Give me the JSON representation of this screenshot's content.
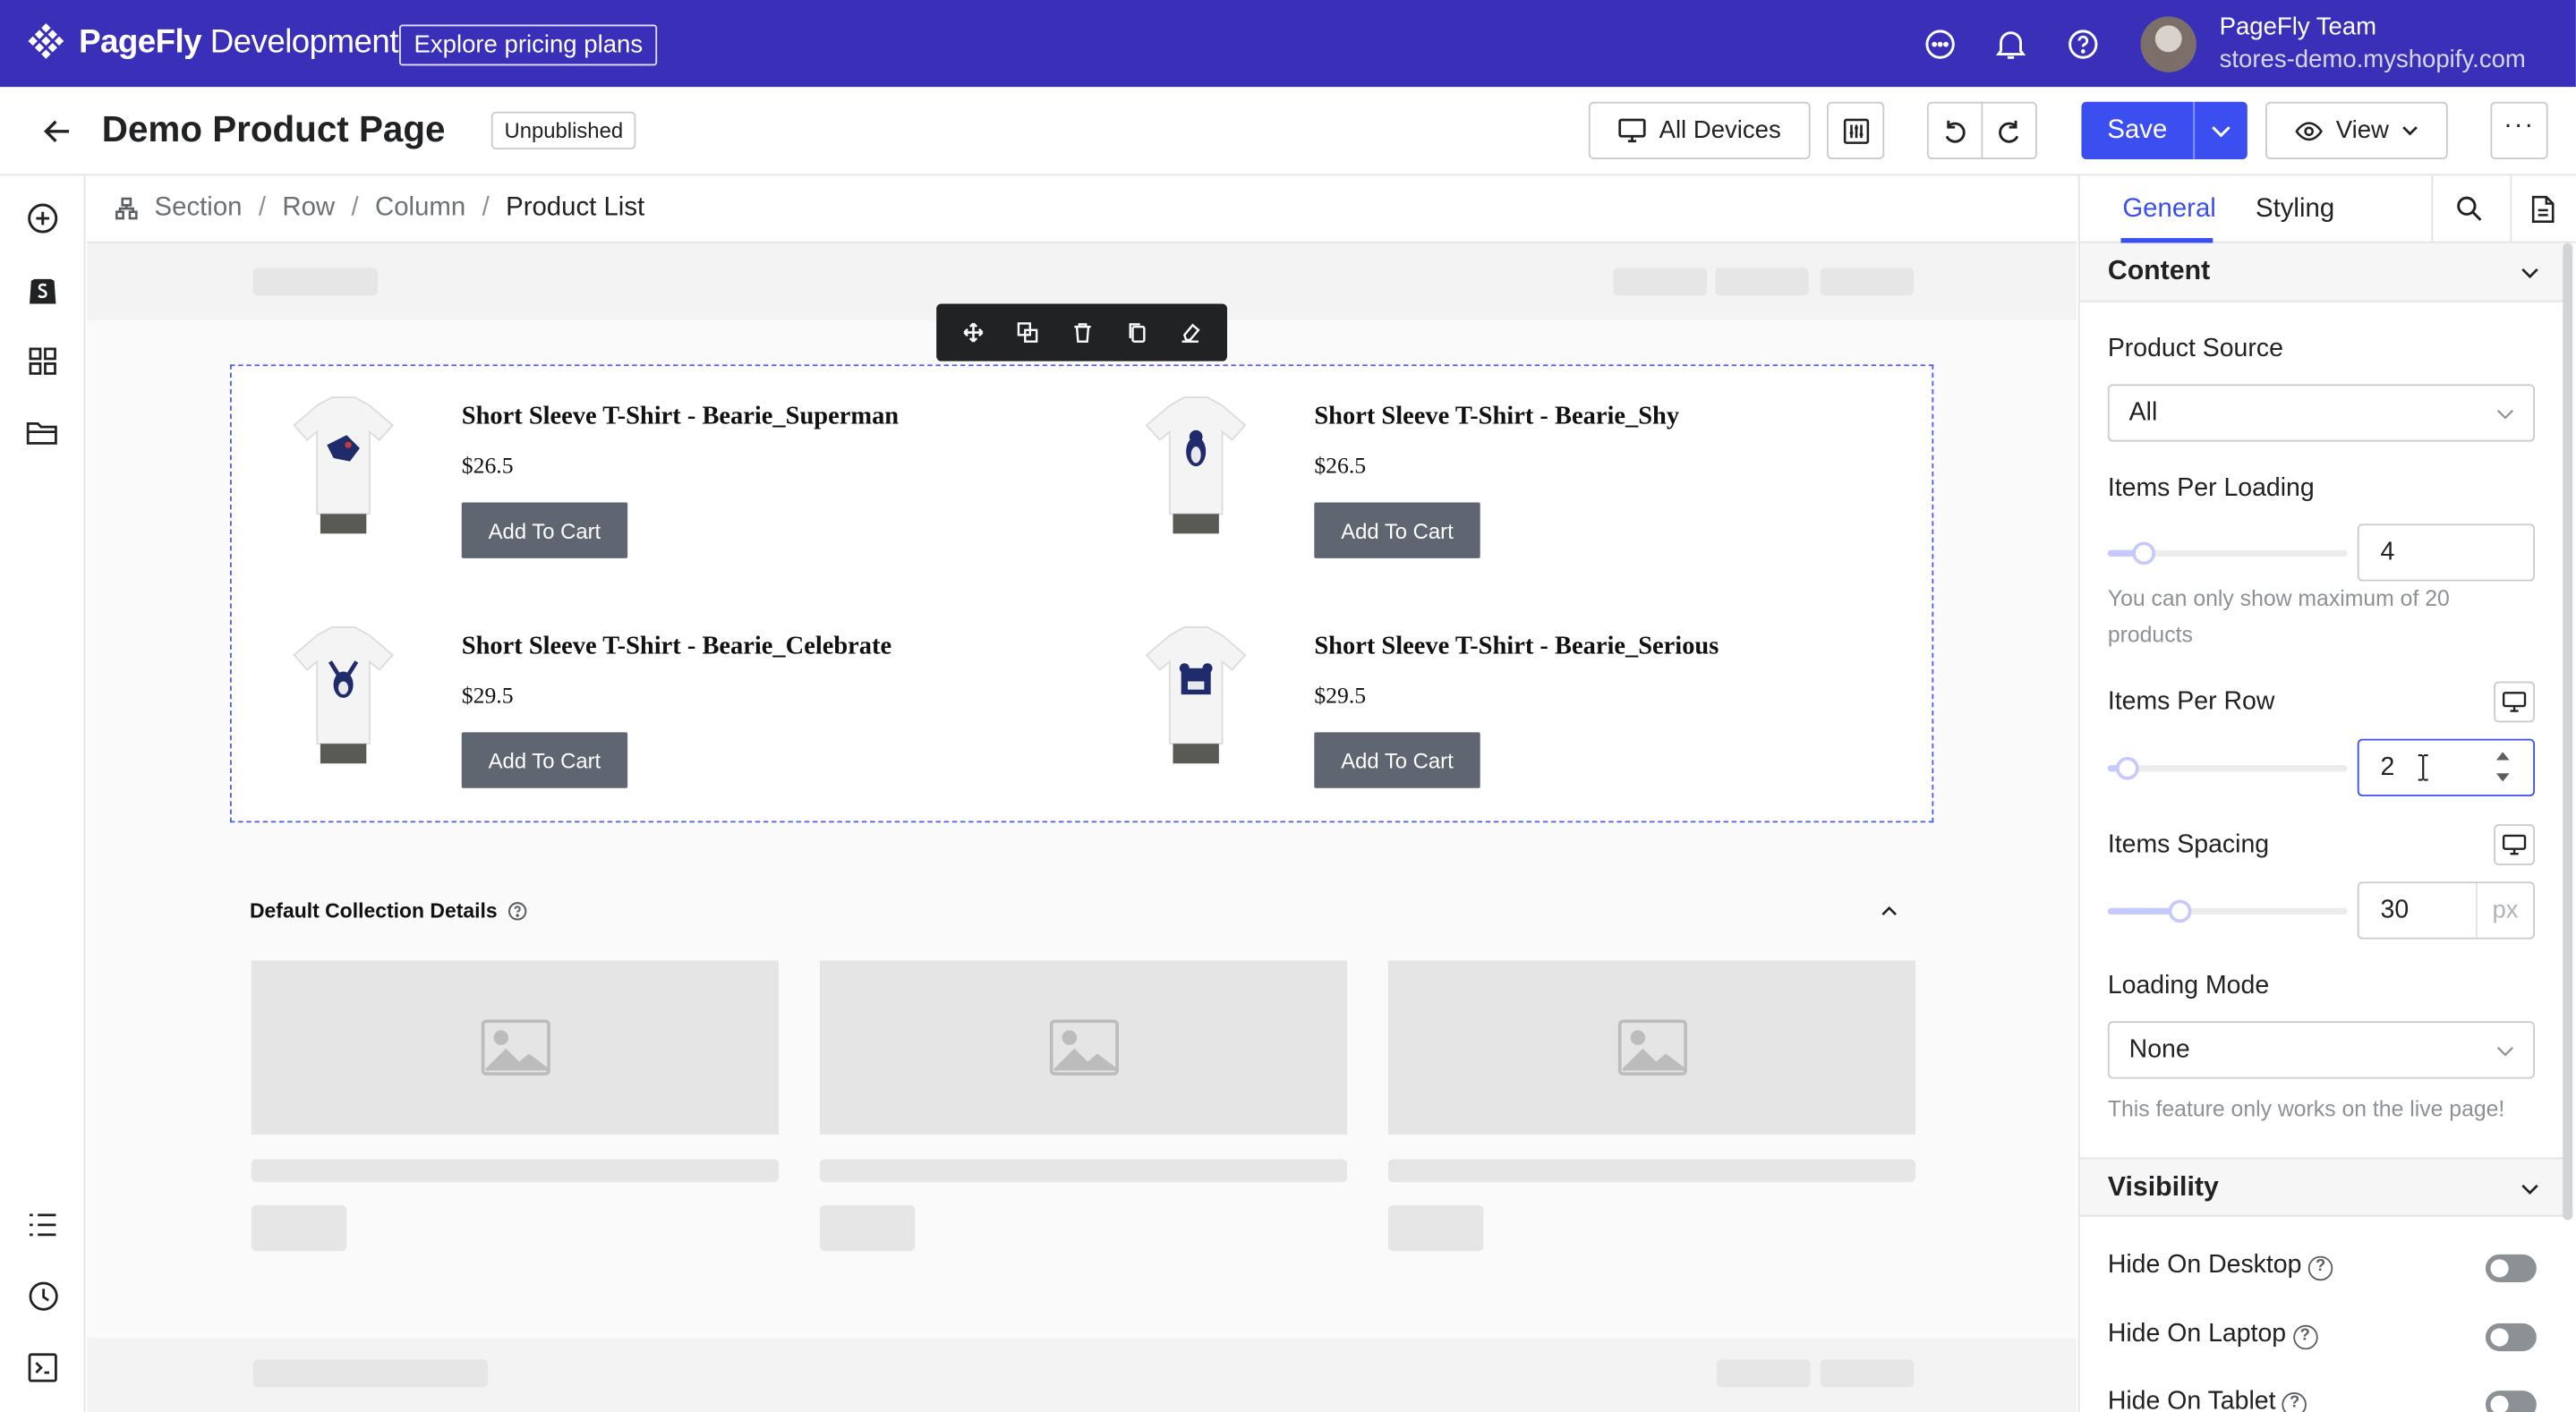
{
  "topbar": {
    "brand_name": "PageFly",
    "brand_suffix": "Development",
    "pricing_label": "Explore pricing plans",
    "user_name": "PageFly Team",
    "user_store": "stores-demo.myshopify.com",
    "bg_color": "#3a2fb8"
  },
  "header": {
    "page_title": "Demo Product Page",
    "status_badge": "Unpublished",
    "devices_label": "All Devices",
    "save_label": "Save",
    "view_label": "View",
    "accent_color": "#3b4ef0"
  },
  "breadcrumb": {
    "items": [
      "Section",
      "Row",
      "Column",
      "Product List"
    ],
    "separator": "/"
  },
  "canvas": {
    "products": [
      {
        "title": "Short Sleeve T-Shirt - Bearie_Superman",
        "price": "$26.5",
        "button": "Add To Cart"
      },
      {
        "title": "Short Sleeve T-Shirt - Bearie_Shy",
        "price": "$26.5",
        "button": "Add To Cart"
      },
      {
        "title": "Short Sleeve T-Shirt - Bearie_Celebrate",
        "price": "$29.5",
        "button": "Add To Cart"
      },
      {
        "title": "Short Sleeve T-Shirt - Bearie_Serious",
        "price": "$29.5",
        "button": "Add To Cart"
      }
    ],
    "collection_heading": "Default Collection Details"
  },
  "panel": {
    "tabs": [
      "General",
      "Styling"
    ],
    "content_heading": "Content",
    "product_source_label": "Product Source",
    "product_source_value": "All",
    "items_per_loading_label": "Items Per Loading",
    "items_per_loading_value": "4",
    "items_per_loading_level": 0.15,
    "max_hint": "You can only show maximum of 20 products",
    "items_per_row_label": "Items Per Row",
    "items_per_row_value": "2",
    "items_per_row_level": 0.08,
    "items_spacing_label": "Items Spacing",
    "items_spacing_value": "30",
    "items_spacing_unit": "px",
    "items_spacing_level": 0.3,
    "loading_mode_label": "Loading Mode",
    "loading_mode_value": "None",
    "live_hint": "This feature only works on the live page!",
    "visibility_heading": "Visibility",
    "hide_desktop": "Hide On Desktop",
    "hide_laptop": "Hide On Laptop",
    "hide_tablet": "Hide On Tablet"
  }
}
